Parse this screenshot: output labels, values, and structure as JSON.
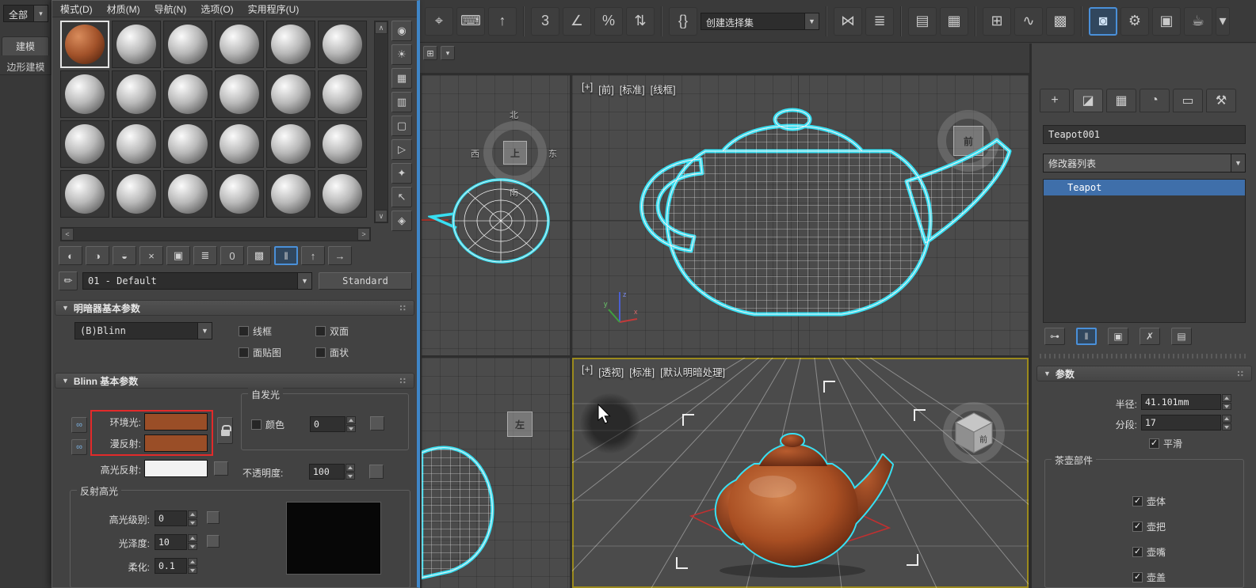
{
  "ui": {
    "check": "✓",
    "caret": "▼",
    "rollout_arrow": "▼",
    "grip": "∷",
    "scroll_up": "∧",
    "scroll_down": "∨",
    "scroll_left": "<",
    "scroll_right": ">",
    "link": "∞",
    "tab_grid": "⊞",
    "tab_caret": "▾"
  },
  "ribbon": {
    "all": "全部",
    "modeling": "建模",
    "poly": "边形建模"
  },
  "toolbar": {
    "selection_set": "创建选择集",
    "buttons": [
      {
        "name": "select-and-manipulate",
        "glyph": "⌖"
      },
      {
        "name": "keyboard-override",
        "glyph": "⌨"
      },
      {
        "name": "isolate-selection",
        "glyph": "↑"
      },
      {
        "name": "snaps-toggle",
        "glyph": "3"
      },
      {
        "name": "angle-snap",
        "glyph": "∠"
      },
      {
        "name": "percent-snap",
        "glyph": "%"
      },
      {
        "name": "spinner-snap",
        "glyph": "⇅"
      },
      {
        "name": "edit-named-selections",
        "glyph": "{}"
      },
      {
        "name": "mirror",
        "glyph": "⋈"
      },
      {
        "name": "align",
        "glyph": "≣"
      },
      {
        "name": "scene-explorer",
        "glyph": "▤"
      },
      {
        "name": "layer-explorer",
        "glyph": "▦"
      },
      {
        "name": "ribbon-toggle",
        "glyph": "⊞"
      },
      {
        "name": "curve-editor",
        "glyph": "∿"
      },
      {
        "name": "schematic-view",
        "glyph": "▩"
      },
      {
        "name": "material-editor",
        "glyph": "◙"
      },
      {
        "name": "render-setup",
        "glyph": "⚙"
      },
      {
        "name": "rendered-frame",
        "glyph": "▣"
      },
      {
        "name": "render-production",
        "glyph": "☕"
      },
      {
        "name": "flyout-arrow",
        "glyph": "▾"
      }
    ]
  },
  "material_editor": {
    "menu": [
      "模式(D)",
      "材质(M)",
      "导航(N)",
      "选项(O)",
      "实用程序(U)"
    ],
    "side_tools": [
      {
        "name": "sample-type",
        "glyph": "◉"
      },
      {
        "name": "backlight",
        "glyph": "☀"
      },
      {
        "name": "background",
        "glyph": "▦"
      },
      {
        "name": "sample-uv-tiling",
        "glyph": "▥"
      },
      {
        "name": "video-color-check",
        "glyph": "▢"
      },
      {
        "name": "make-preview",
        "glyph": "▷"
      },
      {
        "name": "options",
        "glyph": "✦"
      },
      {
        "name": "select-by-material",
        "glyph": "↖"
      },
      {
        "name": "material-map-navigator",
        "glyph": "◈"
      }
    ],
    "tools": [
      {
        "name": "get-material",
        "glyph": "◐"
      },
      {
        "name": "put-to-scene",
        "glyph": "◑"
      },
      {
        "name": "assign-to-selection",
        "glyph": "◒"
      },
      {
        "name": "reset-map",
        "glyph": "×"
      },
      {
        "name": "make-unique",
        "glyph": "▣"
      },
      {
        "name": "put-to-library",
        "glyph": "≣"
      },
      {
        "name": "material-id",
        "glyph": "0"
      },
      {
        "name": "show-in-viewport",
        "glyph": "▩"
      },
      {
        "name": "show-end-result",
        "glyph": "‖"
      },
      {
        "name": "go-to-parent",
        "glyph": "↑"
      },
      {
        "name": "go-forward",
        "glyph": "→"
      }
    ],
    "picker_glyph": "✏",
    "material_name": "01 - Default",
    "material_type": "Standard",
    "shader": {
      "title": "明暗器基本参数",
      "model": "(B)Blinn",
      "wire": "线框",
      "two_sided": "双面",
      "face_map": "面贴图",
      "faceted": "面状"
    },
    "blinn": {
      "title": "Blinn 基本参数",
      "ambient": "环境光:",
      "diffuse": "漫反射:",
      "specular": "高光反射:",
      "self_illum_title": "自发光",
      "color_label": "颜色",
      "self_illum_value": "0",
      "opacity_label": "不透明度:",
      "opacity_value": "100",
      "highlights_title": "反射高光",
      "level_label": "高光级别:",
      "level_value": "0",
      "gloss_label": "光泽度:",
      "gloss_value": "10",
      "soften_label": "柔化:",
      "soften_value": "0.1"
    },
    "swatches": {
      "ambient": "#9a4e27",
      "diffuse": "#9a4e27",
      "specular": "#f2f2f2"
    }
  },
  "viewports": {
    "front": {
      "menu": "[+]",
      "view": "[前]",
      "standard": "[标准]",
      "shading": "[线框]"
    },
    "persp": {
      "menu": "[+]",
      "view": "[透视]",
      "standard": "[标准]",
      "shading": "[默认明暗处理]"
    },
    "compass": {
      "n": "北",
      "e": "东",
      "s": "南",
      "w": "西",
      "center": "上"
    },
    "left_label": "左",
    "cube_front": "前",
    "axis": {
      "x": "x",
      "y": "y",
      "z": "z"
    }
  },
  "panel": {
    "tabs": [
      {
        "name": "create",
        "glyph": "+"
      },
      {
        "name": "modify",
        "glyph": "◪"
      },
      {
        "name": "hierarchy",
        "glyph": "▦"
      },
      {
        "name": "motion",
        "glyph": "◔"
      },
      {
        "name": "display",
        "glyph": "▭"
      },
      {
        "name": "utilities",
        "glyph": "⚒"
      }
    ],
    "object_name": "Teapot001",
    "modifier_list": "修改器列表",
    "stack_item": "Teapot",
    "stack_tools": [
      {
        "name": "pin-stack",
        "glyph": "⊶"
      },
      {
        "name": "show-end-result",
        "glyph": "‖"
      },
      {
        "name": "make-unique",
        "glyph": "▣"
      },
      {
        "name": "remove-modifier",
        "glyph": "✗"
      },
      {
        "name": "configure-modifier-sets",
        "glyph": "▤"
      }
    ],
    "params": {
      "title": "参数",
      "radius_label": "半径:",
      "radius_value": "41.101mm",
      "segments_label": "分段:",
      "segments_value": "17",
      "smooth_label": "平滑",
      "parts_title": "茶壶部件",
      "parts": [
        {
          "label": "壶体"
        },
        {
          "label": "壶把"
        },
        {
          "label": "壶嘴"
        },
        {
          "label": "壶盖"
        }
      ]
    }
  }
}
